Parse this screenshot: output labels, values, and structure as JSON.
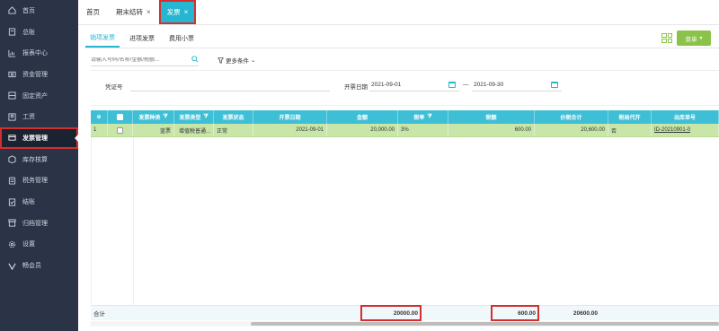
{
  "sidebar": {
    "items": [
      {
        "label": "首页",
        "icon": "home-icon"
      },
      {
        "label": "总账",
        "icon": "ledger-icon"
      },
      {
        "label": "报表中心",
        "icon": "report-icon"
      },
      {
        "label": "资金管理",
        "icon": "money-icon"
      },
      {
        "label": "固定资产",
        "icon": "asset-icon"
      },
      {
        "label": "工资",
        "icon": "salary-icon"
      },
      {
        "label": "发票管理",
        "icon": "invoice-icon"
      },
      {
        "label": "库存核算",
        "icon": "inventory-icon"
      },
      {
        "label": "税务管理",
        "icon": "tax-icon"
      },
      {
        "label": "结账",
        "icon": "close-books-icon"
      },
      {
        "label": "归档管理",
        "icon": "archive-icon"
      },
      {
        "label": "设置",
        "icon": "gear-icon"
      },
      {
        "label": "畅会员",
        "icon": "vip-icon"
      }
    ],
    "active_index": 6
  },
  "tabs": [
    {
      "label": "首页",
      "closable": false
    },
    {
      "label": "期末结转",
      "closable": true
    },
    {
      "label": "发票",
      "closable": true
    }
  ],
  "subtabs": [
    "销项发票",
    "进项发票",
    "费用小票"
  ],
  "toolbar": {
    "menu_label": "菜单",
    "menu_caret": "▾"
  },
  "search": {
    "placeholder": "请输入号码/名称/金额/税额...",
    "more_conditions": "更多条件"
  },
  "filter": {
    "voucher_label": "凭证号",
    "date_label": "开票日期",
    "date_from": "2021-09-01",
    "date_sep": "—",
    "date_to": "2021-09-30"
  },
  "table": {
    "headers": [
      "⊕",
      "",
      "发票种类",
      "发票类型",
      "发票状态",
      "开票日期",
      "金额",
      "税率",
      "税额",
      "价税合计",
      "税局代开",
      "出库单号"
    ],
    "rows": [
      {
        "no": "1",
        "kind": "蓝票",
        "type": "增值税普通...",
        "status": "正常",
        "date": "2021-09-01",
        "amount": "20,000.00",
        "rate": "3%",
        "tax": "600.00",
        "total": "20,600.00",
        "agent": "否",
        "outbound": "ID-20210901-0"
      }
    ],
    "footer": {
      "label": "合计",
      "amount": "20000.00",
      "tax": "600.00",
      "total": "20600.00"
    }
  },
  "colors": {
    "sidebar_bg": "#2b3447",
    "accent": "#26b6d1",
    "header_bg": "#3fbfd6",
    "row_bg": "#c8e6a8",
    "button_green": "#8bc34a",
    "highlight": "#d32f2f"
  }
}
